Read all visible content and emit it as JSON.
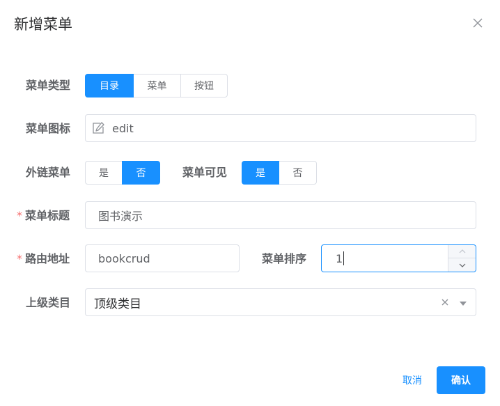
{
  "dialog": {
    "title": "新增菜单",
    "close_icon": "close-icon"
  },
  "form": {
    "menu_type": {
      "label": "菜单类型",
      "options": [
        "目录",
        "菜单",
        "按钮"
      ],
      "selected": "目录"
    },
    "menu_icon": {
      "label": "菜单图标",
      "icon": "edit-icon",
      "value": "edit"
    },
    "external_link": {
      "label": "外链菜单",
      "options": [
        "是",
        "否"
      ],
      "selected": "否"
    },
    "visible": {
      "label": "菜单可见",
      "options": [
        "是",
        "否"
      ],
      "selected": "是"
    },
    "menu_title": {
      "label": "菜单标题",
      "required_mark": "*",
      "value": "图书演示"
    },
    "route_path": {
      "label": "路由地址",
      "required_mark": "*",
      "value": "bookcrud"
    },
    "sort_order": {
      "label": "菜单排序",
      "value": "1"
    },
    "parent_category": {
      "label": "上级类目",
      "value": "顶级类目"
    }
  },
  "footer": {
    "cancel_label": "取消",
    "confirm_label": "确认"
  },
  "colors": {
    "primary": "#1890ff",
    "required": "#f56c6c",
    "border": "#dcdfe6"
  }
}
